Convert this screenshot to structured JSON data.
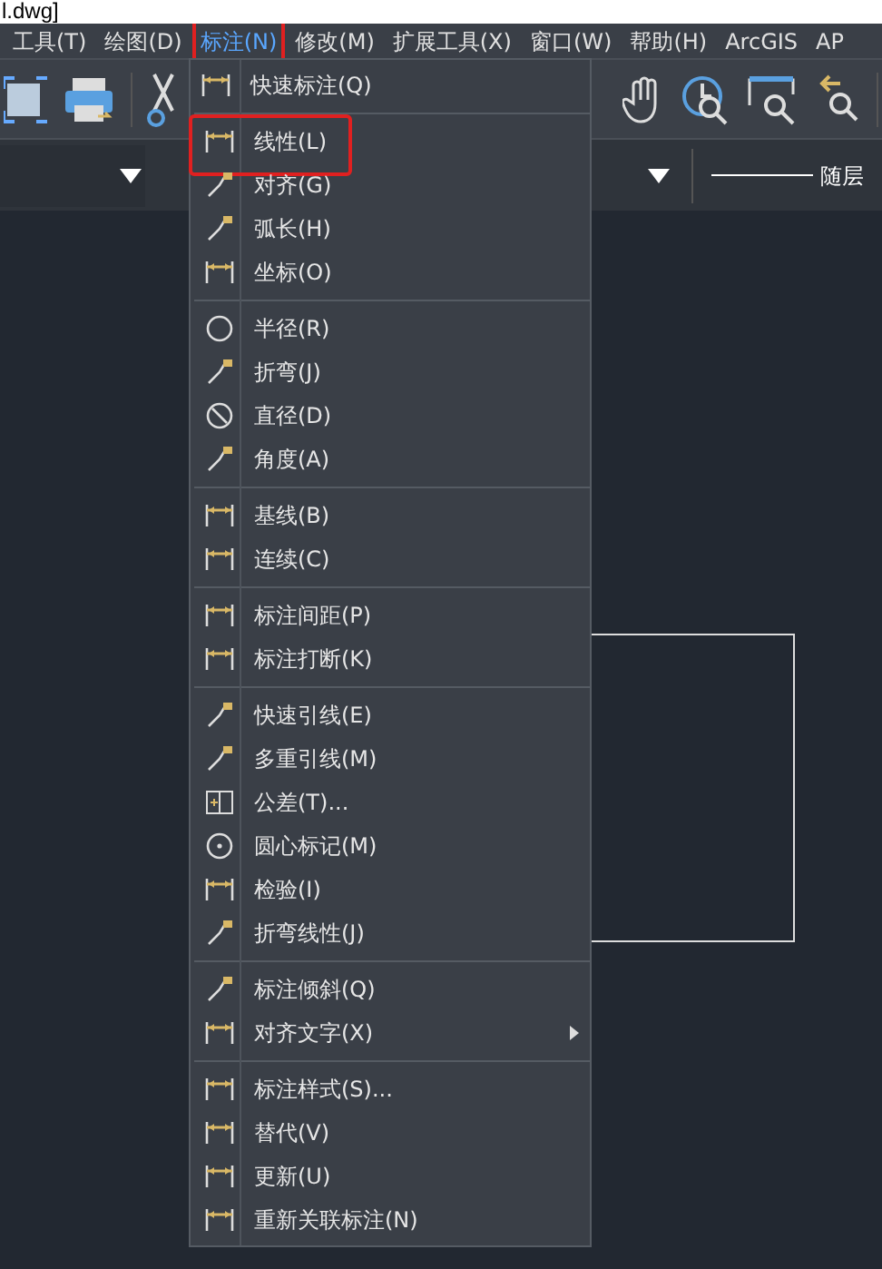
{
  "title_bar": {
    "title": "l.dwg]"
  },
  "menu_bar": [
    {
      "label": "工具(T)",
      "selected": false
    },
    {
      "label": "绘图(D)",
      "selected": false
    },
    {
      "label": "标注(N)",
      "selected": true,
      "highlighted": true
    },
    {
      "label": "修改(M)",
      "selected": false
    },
    {
      "label": "扩展工具(X)",
      "selected": false
    },
    {
      "label": "窗口(W)",
      "selected": false
    },
    {
      "label": "帮助(H)",
      "selected": false
    },
    {
      "label": "ArcGIS",
      "selected": false
    },
    {
      "label": "AP",
      "selected": false
    }
  ],
  "property_bar": {
    "linetype": "随层"
  },
  "dropdown_menu": {
    "groups": [
      [
        {
          "label": "快速标注(Q)",
          "highlighted": false
        }
      ],
      [
        {
          "label": "线性(L)",
          "highlighted": true
        },
        {
          "label": "对齐(G)",
          "highlighted": false
        },
        {
          "label": "弧长(H)",
          "highlighted": false
        },
        {
          "label": "坐标(O)",
          "highlighted": false
        }
      ],
      [
        {
          "label": "半径(R)",
          "highlighted": false
        },
        {
          "label": "折弯(J)",
          "highlighted": false
        },
        {
          "label": "直径(D)",
          "highlighted": false
        },
        {
          "label": "角度(A)",
          "highlighted": false
        }
      ],
      [
        {
          "label": "基线(B)",
          "highlighted": false
        },
        {
          "label": "连续(C)",
          "highlighted": false
        }
      ],
      [
        {
          "label": "标注间距(P)",
          "highlighted": false
        },
        {
          "label": "标注打断(K)",
          "highlighted": false
        }
      ],
      [
        {
          "label": "快速引线(E)",
          "highlighted": false
        },
        {
          "label": "多重引线(M)",
          "highlighted": false
        },
        {
          "label": "公差(T)...",
          "highlighted": false
        },
        {
          "label": "圆心标记(M)",
          "highlighted": false
        },
        {
          "label": "检验(I)",
          "highlighted": false
        },
        {
          "label": "折弯线性(J)",
          "highlighted": false
        }
      ],
      [
        {
          "label": "标注倾斜(Q)",
          "highlighted": false
        },
        {
          "label": "对齐文字(X)",
          "highlighted": false,
          "submenu": true
        }
      ],
      [
        {
          "label": "标注样式(S)...",
          "highlighted": false
        },
        {
          "label": "替代(V)",
          "highlighted": false
        },
        {
          "label": "更新(U)",
          "highlighted": false
        },
        {
          "label": "重新关联标注(N)",
          "highlighted": false
        }
      ]
    ]
  }
}
